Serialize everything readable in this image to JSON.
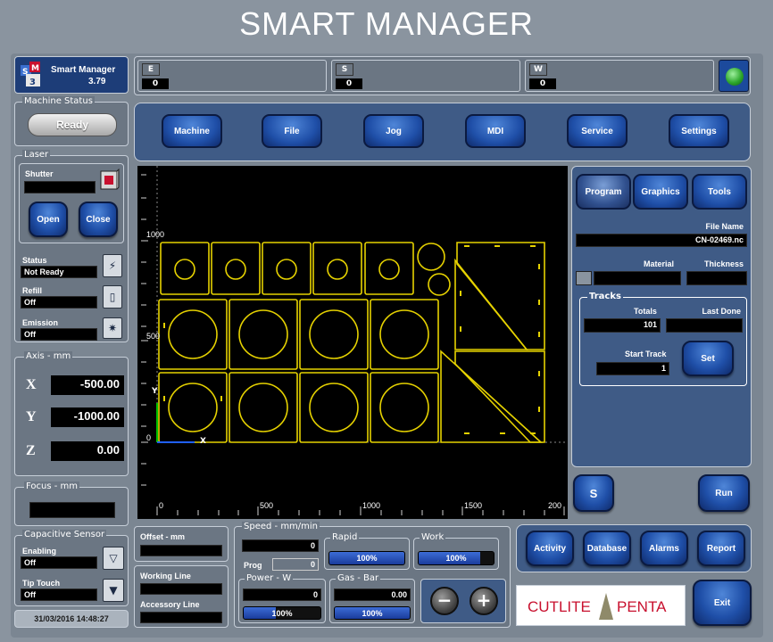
{
  "header": {
    "title": "SMART MANAGER"
  },
  "app": {
    "logo_text": "SM3",
    "name": "Smart Manager",
    "version": "3.79"
  },
  "topbar": {
    "counters": [
      {
        "letter": "E",
        "value": "0"
      },
      {
        "letter": "S",
        "value": "0"
      },
      {
        "letter": "W",
        "value": "0"
      }
    ],
    "status_light_color": "#2ea82e"
  },
  "machine_status": {
    "legend": "Machine Status",
    "state": "Ready"
  },
  "laser": {
    "legend": "Laser",
    "shutter_label": "Shutter",
    "shutter_value": "",
    "open_label": "Open",
    "close_label": "Close",
    "status_label": "Status",
    "status_value": "Not Ready",
    "refill_label": "Refill",
    "refill_value": "Off",
    "emission_label": "Emission",
    "emission_value": "Off"
  },
  "axis": {
    "legend": "Axis - mm",
    "x_label": "X",
    "x_value": "-500.00",
    "y_label": "Y",
    "y_value": "-1000.00",
    "z_label": "Z",
    "z_value": "0.00"
  },
  "focus": {
    "legend": "Focus - mm",
    "value": ""
  },
  "capacitive": {
    "legend": "Capacitive Sensor",
    "enabling_label": "Enabling",
    "enabling_value": "Off",
    "tip_label": "Tip Touch",
    "tip_value": "Off"
  },
  "datetime": "31/03/2016 14:48:27",
  "nav": {
    "tabs": [
      "Machine",
      "File",
      "Jog",
      "MDI",
      "Service",
      "Settings"
    ]
  },
  "canvas": {
    "y_ticks": [
      "1000",
      "500",
      "0"
    ],
    "x_ticks": [
      "0",
      "500",
      "1000",
      "1500",
      "200"
    ],
    "origin_x_label": "X",
    "origin_y_label": "Y",
    "part_color": "#e6d200"
  },
  "right_panel": {
    "tabs": [
      "Program",
      "Graphics",
      "Tools"
    ],
    "file_name_label": "File Name",
    "file_name_value": "CN-02469.nc",
    "material_label": "Material",
    "material_value": "",
    "thickness_label": "Thickness",
    "thickness_value": "",
    "tracks_legend": "Tracks",
    "totals_label": "Totals",
    "totals_value": "101",
    "last_done_label": "Last Done",
    "last_done_value": "",
    "start_track_label": "Start Track",
    "start_track_value": "1",
    "set_label": "Set",
    "s_button_label": "S",
    "run_label": "Run"
  },
  "offset": {
    "label": "Offset - mm",
    "value": ""
  },
  "lines": {
    "working_label": "Working Line",
    "working_value": "",
    "accessory_label": "Accessory Line",
    "accessory_value": ""
  },
  "speed": {
    "legend": "Speed - mm/min",
    "value": "0",
    "prog_label": "Prog",
    "prog_value": "0",
    "rapid_legend": "Rapid",
    "rapid_pct": "100%",
    "rapid_fill": 1.0,
    "work_legend": "Work",
    "work_pct": "100%",
    "work_fill": 0.82
  },
  "power": {
    "legend": "Power - W",
    "value": "0",
    "pct": "100%",
    "fill": 0.42
  },
  "gas": {
    "legend": "Gas - Bar",
    "value": "0.00",
    "pct": "100%",
    "fill": 1.0
  },
  "minus_label": "−",
  "plus_label": "+",
  "bottom_buttons": [
    "Activity",
    "Database",
    "Alarms",
    "Report"
  ],
  "brand": {
    "left": "CUTLITE",
    "right": "PENTA",
    "color": "#c8102e"
  },
  "exit_label": "Exit"
}
